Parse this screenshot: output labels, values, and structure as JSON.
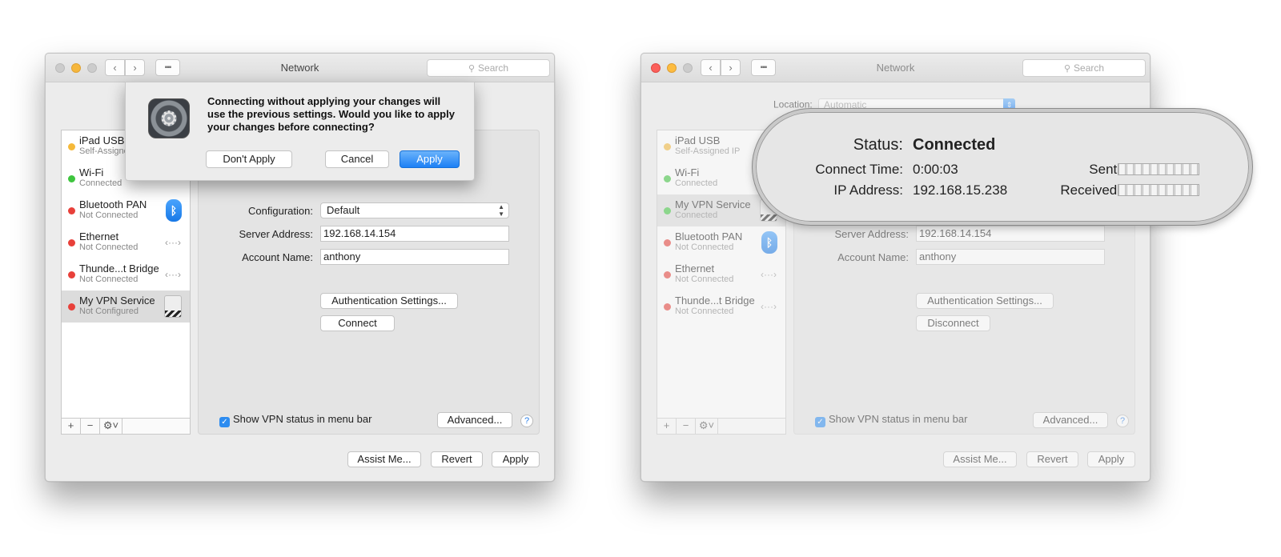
{
  "window_title": "Network",
  "search_placeholder": "Search",
  "location": {
    "label": "Location:",
    "value": "Automatic"
  },
  "services_left": [
    {
      "name": "iPad USB",
      "status": "Self-Assigned IP",
      "dot": "yellow"
    },
    {
      "name": "Wi-Fi",
      "status": "Connected",
      "dot": "green"
    },
    {
      "name": "Bluetooth PAN",
      "status": "Not Connected",
      "dot": "red"
    },
    {
      "name": "Ethernet",
      "status": "Not Connected",
      "dot": "red"
    },
    {
      "name": "Thunde...t Bridge",
      "status": "Not Connected",
      "dot": "red"
    },
    {
      "name": "My VPN Service",
      "status": "Not Configured",
      "dot": "red"
    }
  ],
  "services_right": [
    {
      "name": "iPad USB",
      "status": "Self-Assigned IP",
      "dot": "yellow"
    },
    {
      "name": "Wi-Fi",
      "status": "Connected",
      "dot": "green"
    },
    {
      "name": "My VPN Service",
      "status": "Connected",
      "dot": "green"
    },
    {
      "name": "Bluetooth PAN",
      "status": "Not Connected",
      "dot": "red"
    },
    {
      "name": "Ethernet",
      "status": "Not Connected",
      "dot": "red"
    },
    {
      "name": "Thunde...t Bridge",
      "status": "Not Connected",
      "dot": "red"
    }
  ],
  "form": {
    "configuration_label": "Configuration:",
    "configuration_value": "Default",
    "server_label": "Server Address:",
    "server_value": "192.168.14.154",
    "account_label": "Account Name:",
    "account_value": "anthony",
    "auth_button": "Authentication Settings...",
    "connect_button": "Connect",
    "disconnect_button": "Disconnect",
    "show_status_label": "Show VPN status in menu bar",
    "advanced_button": "Advanced...",
    "help": "?"
  },
  "footer": {
    "assist": "Assist Me...",
    "revert": "Revert",
    "apply": "Apply"
  },
  "dialog": {
    "message": "Connecting without applying your changes will use the previous settings. Would you like to apply your changes before connecting?",
    "dont_apply": "Don't Apply",
    "cancel": "Cancel",
    "apply": "Apply"
  },
  "status_callout": {
    "status_label": "Status:",
    "status_value": "Connected",
    "connect_time_label": "Connect Time:",
    "connect_time_value": "0:00:03",
    "ip_label": "IP Address:",
    "ip_value": "192.168.15.238",
    "sent_label": "Sent:",
    "received_label": "Received:"
  },
  "colors": {
    "accent": "#1c80f5",
    "dot_green": "#3ec53e",
    "dot_red": "#e8403a",
    "dot_yellow": "#f5b93a"
  }
}
